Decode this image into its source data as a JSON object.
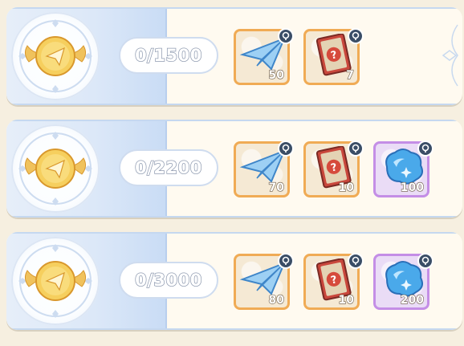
{
  "rows": [
    {
      "progress": "0/1500",
      "rewards": [
        {
          "icon": "paper-plane-icon",
          "quantity": "50",
          "rarity": "orange"
        },
        {
          "icon": "card-pack-icon",
          "quantity": "7",
          "rarity": "orange"
        }
      ]
    },
    {
      "progress": "0/2200",
      "rewards": [
        {
          "icon": "paper-plane-icon",
          "quantity": "70",
          "rarity": "orange"
        },
        {
          "icon": "card-pack-icon",
          "quantity": "10",
          "rarity": "orange"
        },
        {
          "icon": "blue-crystal-icon",
          "quantity": "100",
          "rarity": "purple"
        }
      ]
    },
    {
      "progress": "0/3000",
      "rewards": [
        {
          "icon": "paper-plane-icon",
          "quantity": "80",
          "rarity": "orange"
        },
        {
          "icon": "card-pack-icon",
          "quantity": "10",
          "rarity": "orange"
        },
        {
          "icon": "blue-crystal-icon",
          "quantity": "200",
          "rarity": "purple"
        }
      ]
    }
  ],
  "colors": {
    "orange_border": "#f0ab55",
    "purple_border": "#c48ee6",
    "panel_blue": "#dce8f8",
    "medal_gold": "#f2c24a"
  }
}
